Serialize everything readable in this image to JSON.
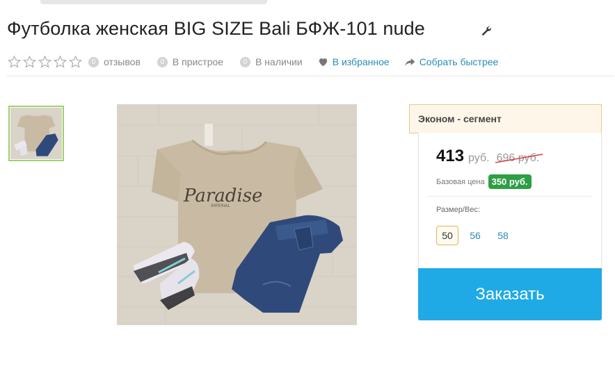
{
  "product": {
    "title": "Футболка женская BIG SIZE Bali БФЖ-101 nude"
  },
  "meta": {
    "rating_stars": 5,
    "reviews_count": "0",
    "reviews_label": "отзывов",
    "stock1_count": "0",
    "stock1_label": "В пристрое",
    "stock2_count": "0",
    "stock2_label": "В наличии",
    "favorites_label": "В избранное",
    "share_label": "Собрать быстрее"
  },
  "pricing": {
    "segment_label": "Эконом - сегмент",
    "price": "413",
    "currency": "руб.",
    "old_price": "696 руб.",
    "base_price_label": "Базовая цена",
    "base_price": "350 руб."
  },
  "sizes": {
    "label": "Размер/Вес:",
    "options": [
      "50",
      "56",
      "58"
    ],
    "selected": "50"
  },
  "actions": {
    "order_label": "Заказать"
  },
  "photo": {
    "print_text": "Paradise",
    "colors": {
      "floor": "#d9d3c8",
      "tshirt": "#c9bba3",
      "jeans": "#2f4a7a",
      "accent_blue": "#1faae6",
      "link": "#2a8bb8",
      "badge_green": "#2e9e44",
      "thumb_border": "#9fcf6b"
    }
  }
}
